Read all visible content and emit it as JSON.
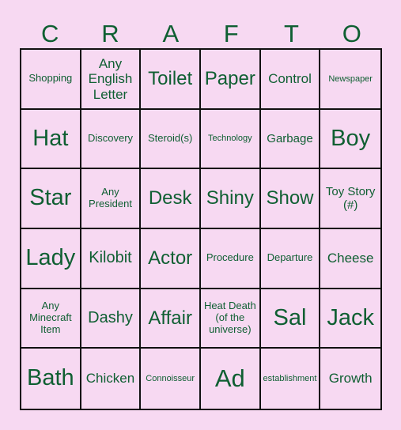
{
  "header": {
    "letters": [
      "C",
      "R",
      "A",
      "F",
      "T",
      "O"
    ]
  },
  "board": {
    "rows": [
      [
        "Shopping",
        "Any English Letter",
        "Toilet",
        "Paper",
        "Control",
        "Newspaper"
      ],
      [
        "Hat",
        "Discovery",
        "Steroid(s)",
        "Technology",
        "Garbage",
        "Boy"
      ],
      [
        "Star",
        "Any President",
        "Desk",
        "Shiny",
        "Show",
        "Toy Story (#)"
      ],
      [
        "Lady",
        "Kilobit",
        "Actor",
        "Procedure",
        "Departure",
        "Cheese"
      ],
      [
        "Any Minecraft Item",
        "Dashy",
        "Affair",
        "Heat Death (of the universe)",
        "Sal",
        "Jack"
      ],
      [
        "Bath",
        "Chicken",
        "Connoisseur",
        "Ad",
        "establishment",
        "Growth"
      ]
    ]
  },
  "colors": {
    "background": "#f7d9f2",
    "text": "#0f5f32",
    "grid": "#111111"
  }
}
